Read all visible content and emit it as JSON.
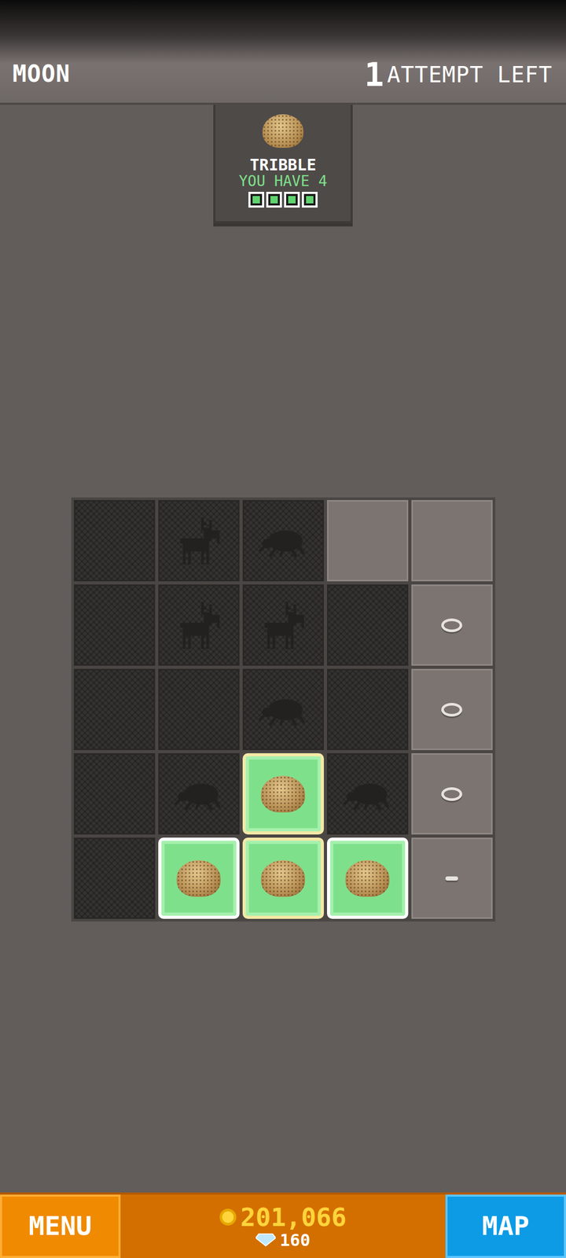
{
  "header": {
    "location": "MOON",
    "attempts": "1",
    "attempts_label": "ATTEMPT LEFT"
  },
  "target": {
    "name": "TRIBBLE",
    "have": "YOU HAVE 4",
    "progress": [
      {
        "filled": true
      },
      {
        "filled": true
      },
      {
        "filled": true
      },
      {
        "filled": true
      }
    ]
  },
  "board": {
    "rows": [
      [
        {
          "kind": "dug"
        },
        {
          "kind": "moose"
        },
        {
          "kind": "beetle"
        },
        {
          "kind": "unknown"
        },
        {
          "kind": "unknown"
        }
      ],
      [
        {
          "kind": "dug"
        },
        {
          "kind": "moose"
        },
        {
          "kind": "moose"
        },
        {
          "kind": "dug"
        },
        {
          "kind": "ring"
        }
      ],
      [
        {
          "kind": "dug"
        },
        {
          "kind": "dug"
        },
        {
          "kind": "beetle"
        },
        {
          "kind": "dug"
        },
        {
          "kind": "ring"
        }
      ],
      [
        {
          "kind": "dug"
        },
        {
          "kind": "beetle"
        },
        {
          "kind": "tribble",
          "color": "#f3e9a6"
        },
        {
          "kind": "beetle"
        },
        {
          "kind": "ring"
        }
      ],
      [
        {
          "kind": "dug"
        },
        {
          "kind": "tribble",
          "color": "#ffffff"
        },
        {
          "kind": "tribble",
          "color": "#f3e9a6"
        },
        {
          "kind": "tribble",
          "color": "#ffffff"
        },
        {
          "kind": "dot"
        }
      ]
    ]
  },
  "footer": {
    "menu": "MENU",
    "coins": "201,066",
    "gems": "160",
    "map": "MAP"
  }
}
